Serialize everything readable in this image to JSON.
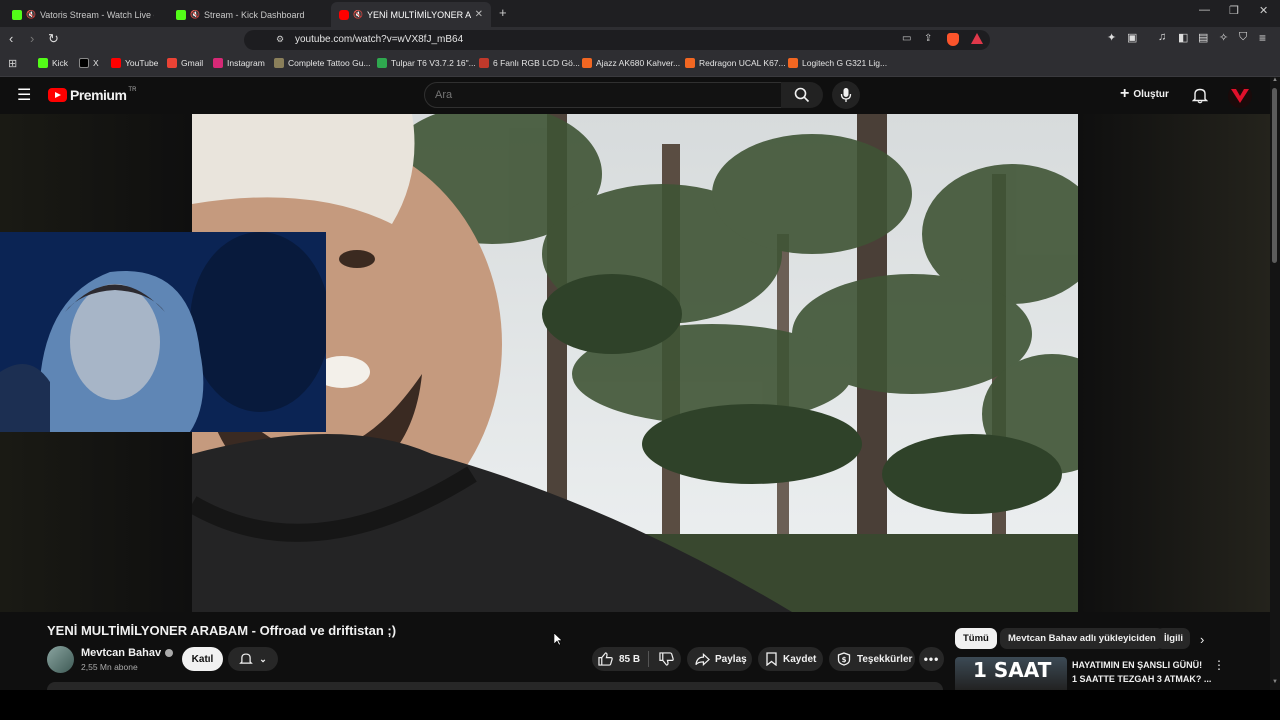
{
  "browser": {
    "tabs": [
      {
        "label": "Vatoris Stream - Watch Live on K",
        "favicon_color": "#53fc18"
      },
      {
        "label": "Stream - Kick Dashboard",
        "favicon_color": "#53fc18"
      },
      {
        "label": "YENİ MULTİMİLYONER ARABA",
        "favicon_color": "#ff0000"
      }
    ],
    "url": "youtube.com/watch?v=wVX8fJ_mB64",
    "bookmarks": [
      {
        "label": "Kick",
        "color": "#53fc18"
      },
      {
        "label": "X",
        "color": "#000000"
      },
      {
        "label": "YouTube",
        "color": "#ff0000"
      },
      {
        "label": "Gmail",
        "color": "#ea4335"
      },
      {
        "label": "Instagram",
        "color": "#d62976"
      },
      {
        "label": "Complete Tattoo Gu...",
        "color": "#8a7f5a"
      },
      {
        "label": "Tulpar T6 V3.7.2 16\"...",
        "color": "#2fa84f"
      },
      {
        "label": "6 Fanlı RGB LCD Gö...",
        "color": "#c0392b"
      },
      {
        "label": "Ajazz AK680 Kahver...",
        "color": "#f26722"
      },
      {
        "label": "Redragon UCAL K67...",
        "color": "#f26722"
      },
      {
        "label": "Logitech G G321 Lig...",
        "color": "#f26722"
      }
    ]
  },
  "youtube": {
    "logo_text": "Premium",
    "region": "TR",
    "search_placeholder": "Ara",
    "create_label": "Oluştur",
    "video": {
      "title": "YENİ MULTİMİLYONER ARABAM - Offroad ve driftistan ;)",
      "channel": "Mevtcan Bahav",
      "subscribers": "2,55 Mn abone",
      "join_label": "Katıl",
      "likes": "85 B",
      "share_label": "Paylaş",
      "save_label": "Kaydet",
      "thanks_label": "Teşekkürler"
    },
    "chips": [
      "Tümü",
      "Mevtcan Bahav adlı yükleyiciden",
      "İlgili"
    ],
    "recommended": {
      "title_line1": "HAYATIMIN EN ŞANSLI GÜNÜ!",
      "title_line2": "1 SAATTE TEZGAH 3 ATMAK? ...",
      "thumb_text": "1 SAAT"
    }
  },
  "colors": {
    "accent_red": "#ff0000",
    "kick_green": "#53fc18"
  }
}
